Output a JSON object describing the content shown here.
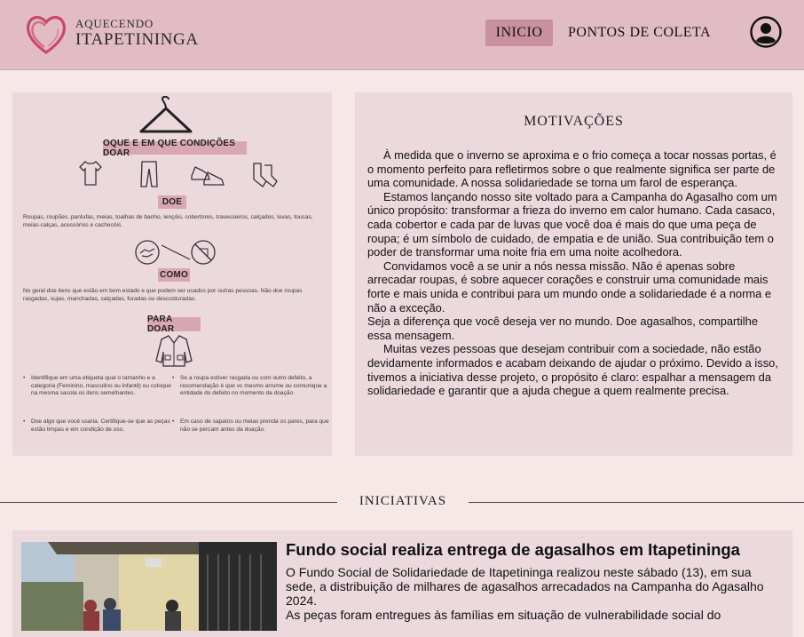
{
  "header": {
    "brand_line1": "AQUECENDO",
    "brand_line2": "ITAPETININGA",
    "nav": [
      "INICIO",
      "PONTOS DE COLETA"
    ],
    "logo_icon": "heart-logo-icon",
    "profile_icon": "user-profile-icon"
  },
  "colors": {
    "header_bg": "#e2bcc5",
    "nav_active_bg": "#c9909f",
    "page_bg": "#f6e8e6",
    "card_bg": "#ecd9dd",
    "pill_bg": "#d9a6b3"
  },
  "info": {
    "heading": "OQUE E EM QUE CONDIÇÕES DOAR",
    "doe_label": "DOE",
    "doe_text": "Roupas, roupões, pantufas, meias, toalhas de banho, lençóis, cobertores, travesseiros, calçados, luvas, toucas, meias-calças, acessórios e cachecóis.",
    "como_label": "COMO",
    "como_text": "No geral doe itens que estão em bom estado e que podem ser usados por outras pessoas. Não doe roupas rasgadas, sujas, manchadas, calçadas, furadas ou descosturadas.",
    "paradoar_label": "PARA DOAR",
    "bullets": [
      "Identifique em uma etiqueta qual o tamanho e a categoria (Feminino, masculino ou infantil) ou coloque na mesma sacola os itens semelhantes.",
      "Se a roupa estiver rasgada ou com outro defeito, a recomendação é que vc mesmo arrume ou comunique a entidade do defeito no momento da doação.",
      "Doe algo que você usaria. Certifique-se que as peças estão limpas e em condição de uso.",
      "Em caso de sapatos ou meias prenda os pares, para que não se percam antes da doação."
    ]
  },
  "motivacoes": {
    "title": "MOTIVAÇÕES",
    "paragraphs": [
      "À medida que o inverno se aproxima e o frio começa a tocar nossas portas, é o momento perfeito para refletirmos sobre o que realmente significa ser parte de uma comunidade. A nossa solidariedade se torna um farol de esperança.",
      "Estamos lançando nosso site voltado para a Campanha do Agasalho com um único propósito: transformar a frieza do inverno em calor humano. Cada casaco, cada cobertor e cada par de luvas que você doa é mais do que uma peça de roupa; é um símbolo de cuidado, de empatia e de união. Sua contribuição tem o poder de transformar uma noite fria em uma noite acolhedora.",
      "Convidamos você a se unir a nós nessa missão. Não é apenas sobre arrecadar roupas, é sobre aquecer corações e construir uma comunidade mais forte e mais unida e contribui para um mundo onde a solidariedade é a norma e não a exceção.",
      "Seja a diferença que você deseja ver no mundo. Doe agasalhos, compartilhe essa mensagem.",
      "Muitas vezes pessoas que desejam contribuir com a sociedade, não estão devidamente informados e acabam deixando de ajudar o próximo. Devido a isso, tivemos a iniciativa desse projeto, o propósito é claro: espalhar a mensagem da solidariedade e garantir que a ajuda chegue a quem realmente precisa."
    ]
  },
  "iniciativas": {
    "title": "INICIATIVAS",
    "news": {
      "title": "Fundo social realiza entrega de agasalhos em Itapetininga",
      "paragraphs": [
        "O Fundo Social de Solidariedade de Itapetininga realizou neste sábado (13), em sua sede, a distribuição de milhares de agasalhos arrecadados na Campanha do Agasalho 2024.",
        "As peças foram entregues às famílias em situação de vulnerabilidade social do"
      ]
    }
  }
}
